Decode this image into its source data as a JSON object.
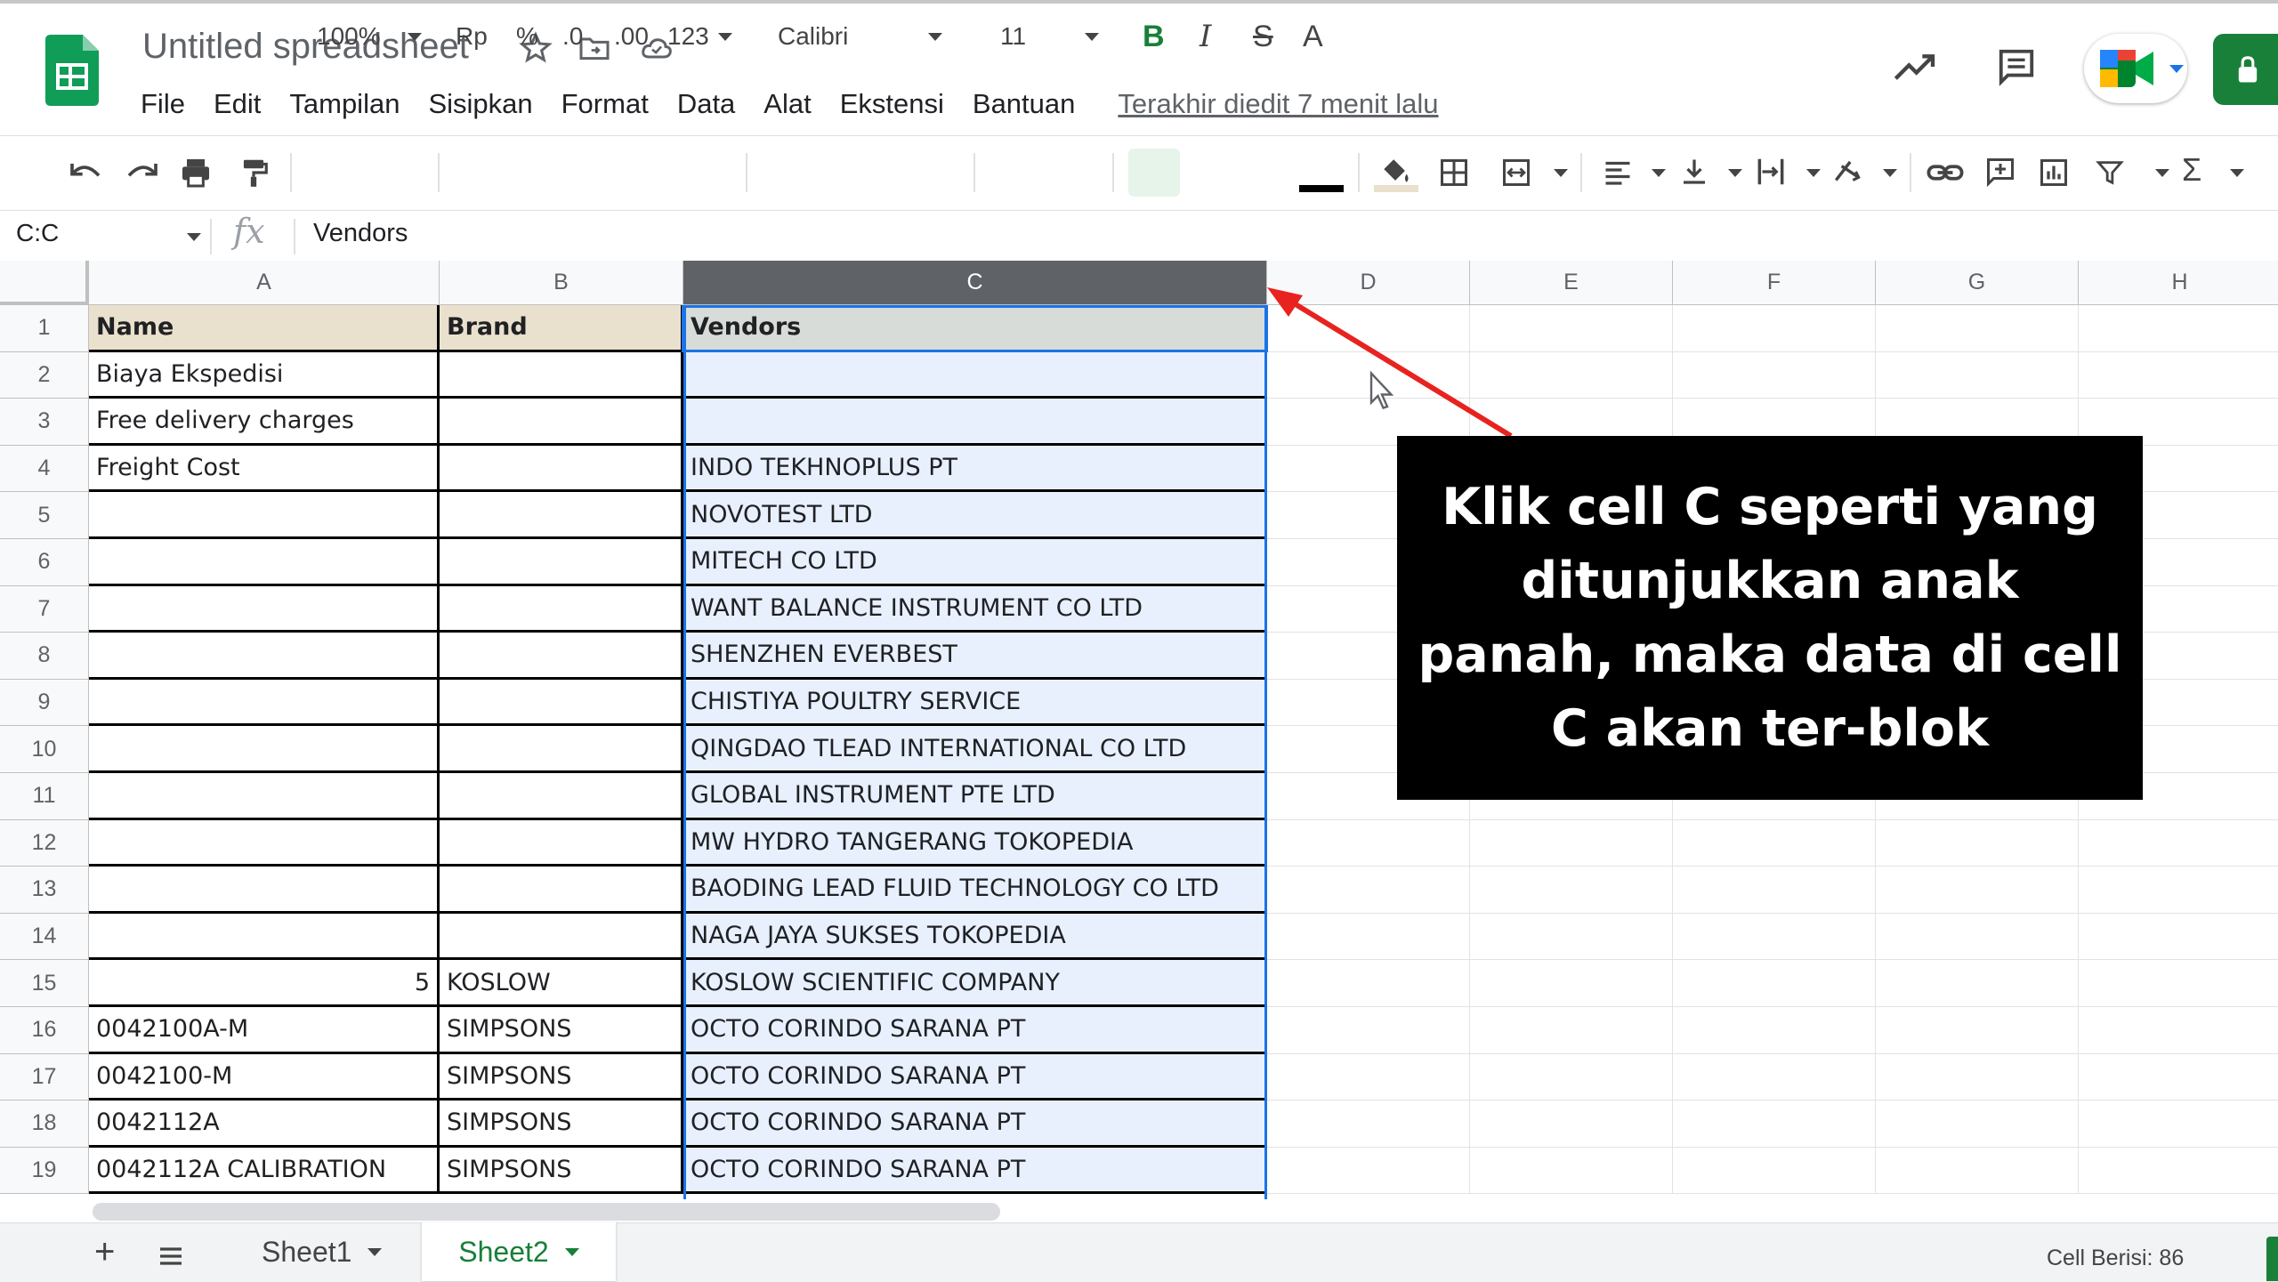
{
  "header": {
    "doc_title": "Untitled spreadsheet",
    "menu": [
      "File",
      "Edit",
      "Tampilan",
      "Sisipkan",
      "Format",
      "Data",
      "Alat",
      "Ekstensi",
      "Bantuan"
    ],
    "last_edit": "Terakhir diedit 7 menit lalu"
  },
  "toolbar": {
    "zoom": "100%",
    "currency": "Rp",
    "percent": "%",
    "dec_decrease": ".0",
    "dec_increase": ".00",
    "more_formats": "123",
    "font": "Calibri",
    "font_size": "11",
    "bold": "B",
    "italic": "I",
    "strike": "S",
    "text_color": "A"
  },
  "formula_bar": {
    "name_box": "C:C",
    "fx": "fx",
    "value": "Vendors"
  },
  "columns": [
    "A",
    "B",
    "C",
    "D",
    "E",
    "F",
    "G",
    "H"
  ],
  "selected_column": "C",
  "rows": [
    {
      "n": "1",
      "a": "Name",
      "b": "Brand",
      "c": "Vendors"
    },
    {
      "n": "2",
      "a": "Biaya Ekspedisi",
      "b": "",
      "c": ""
    },
    {
      "n": "3",
      "a": "Free delivery charges",
      "b": "",
      "c": ""
    },
    {
      "n": "4",
      "a": "Freight Cost",
      "b": "",
      "c": "INDO TEKHNOPLUS PT"
    },
    {
      "n": "5",
      "a": "",
      "b": "",
      "c": "NOVOTEST LTD"
    },
    {
      "n": "6",
      "a": "",
      "b": "",
      "c": "MITECH CO LTD"
    },
    {
      "n": "7",
      "a": "",
      "b": "",
      "c": "WANT BALANCE INSTRUMENT CO LTD"
    },
    {
      "n": "8",
      "a": "",
      "b": "",
      "c": "SHENZHEN EVERBEST"
    },
    {
      "n": "9",
      "a": "",
      "b": "",
      "c": "CHISTIYA POULTRY SERVICE"
    },
    {
      "n": "10",
      "a": "",
      "b": "",
      "c": "QINGDAO TLEAD INTERNATIONAL CO LTD"
    },
    {
      "n": "11",
      "a": "",
      "b": "",
      "c": "GLOBAL INSTRUMENT PTE LTD"
    },
    {
      "n": "12",
      "a": "",
      "b": "",
      "c": "MW HYDRO TANGERANG TOKOPEDIA"
    },
    {
      "n": "13",
      "a": "",
      "b": "",
      "c": "BAODING LEAD FLUID TECHNOLOGY CO LTD"
    },
    {
      "n": "14",
      "a": "",
      "b": "",
      "c": "NAGA JAYA SUKSES TOKOPEDIA"
    },
    {
      "n": "15",
      "a": "5",
      "b": "KOSLOW",
      "c": "KOSLOW SCIENTIFIC COMPANY"
    },
    {
      "n": "16",
      "a": "0042100A-M",
      "b": "SIMPSONS",
      "c": "OCTO CORINDO SARANA PT"
    },
    {
      "n": "17",
      "a": "0042100-M",
      "b": "SIMPSONS",
      "c": "OCTO CORINDO SARANA PT"
    },
    {
      "n": "18",
      "a": "0042112A",
      "b": "SIMPSONS",
      "c": "OCTO CORINDO SARANA PT"
    },
    {
      "n": "19",
      "a": "0042112A CALIBRATION",
      "b": "SIMPSONS",
      "c": "OCTO CORINDO SARANA PT"
    }
  ],
  "callout": {
    "text": "Klik cell C seperti yang ditunjukkan anak panah, maka data di cell C akan ter-blok"
  },
  "sheets": {
    "add": "+",
    "tabs": [
      "Sheet1",
      "Sheet2"
    ],
    "active": "Sheet2"
  },
  "status": {
    "cell_count": "Cell Berisi: 86"
  },
  "colors": {
    "brand_green": "#188038",
    "selection_blue": "#1a73e8",
    "selected_fill": "#e8f0fe",
    "header_fill": "#e9e1cd",
    "arrow_red": "#e8231f"
  }
}
